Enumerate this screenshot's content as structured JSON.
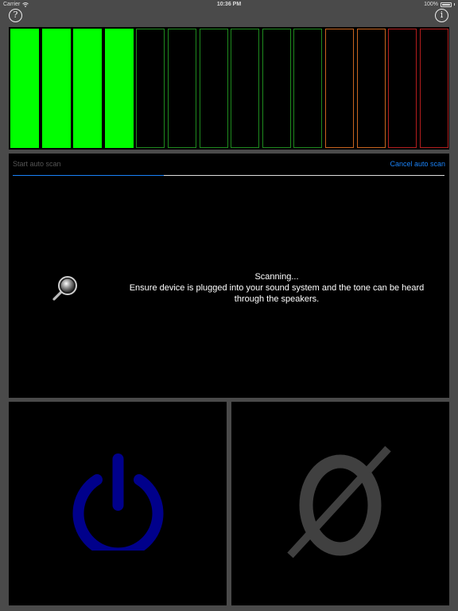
{
  "status_bar": {
    "carrier": "Carrier",
    "time": "10:36 PM",
    "battery": "100%"
  },
  "top_buttons": {
    "help_glyph": "?",
    "info_glyph": "i"
  },
  "meter": {
    "bars": [
      {
        "state": "lit",
        "color": "#00ff00"
      },
      {
        "state": "lit",
        "color": "#00ff00"
      },
      {
        "state": "lit",
        "color": "#00ff00"
      },
      {
        "state": "lit",
        "color": "#00ff00"
      },
      {
        "state": "off",
        "color": "#1e8a1e"
      },
      {
        "state": "off",
        "color": "#1e8a1e"
      },
      {
        "state": "off",
        "color": "#1e8a1e"
      },
      {
        "state": "off",
        "color": "#1e8a1e"
      },
      {
        "state": "off",
        "color": "#1e8a1e"
      },
      {
        "state": "off",
        "color": "#1e8a1e"
      },
      {
        "state": "off",
        "color": "#c8641e"
      },
      {
        "state": "off",
        "color": "#c8641e"
      },
      {
        "state": "off",
        "color": "#b41e1e"
      },
      {
        "state": "off",
        "color": "#b41e1e"
      }
    ]
  },
  "scan": {
    "start_label": "Start auto scan",
    "cancel_label": "Cancel auto scan",
    "progress": 0.35,
    "progress_color": "#1a82f7",
    "status_line": "Scanning...",
    "instruction_line1": "Ensure device is plugged into your sound system and the tone can be heard",
    "instruction_line2": "through the speakers.",
    "icon": "magnifier-icon"
  },
  "controls": {
    "power_icon": "power-icon",
    "power_color": "#00008b",
    "phase_icon": "phase-icon",
    "phase_color": "#404040"
  }
}
